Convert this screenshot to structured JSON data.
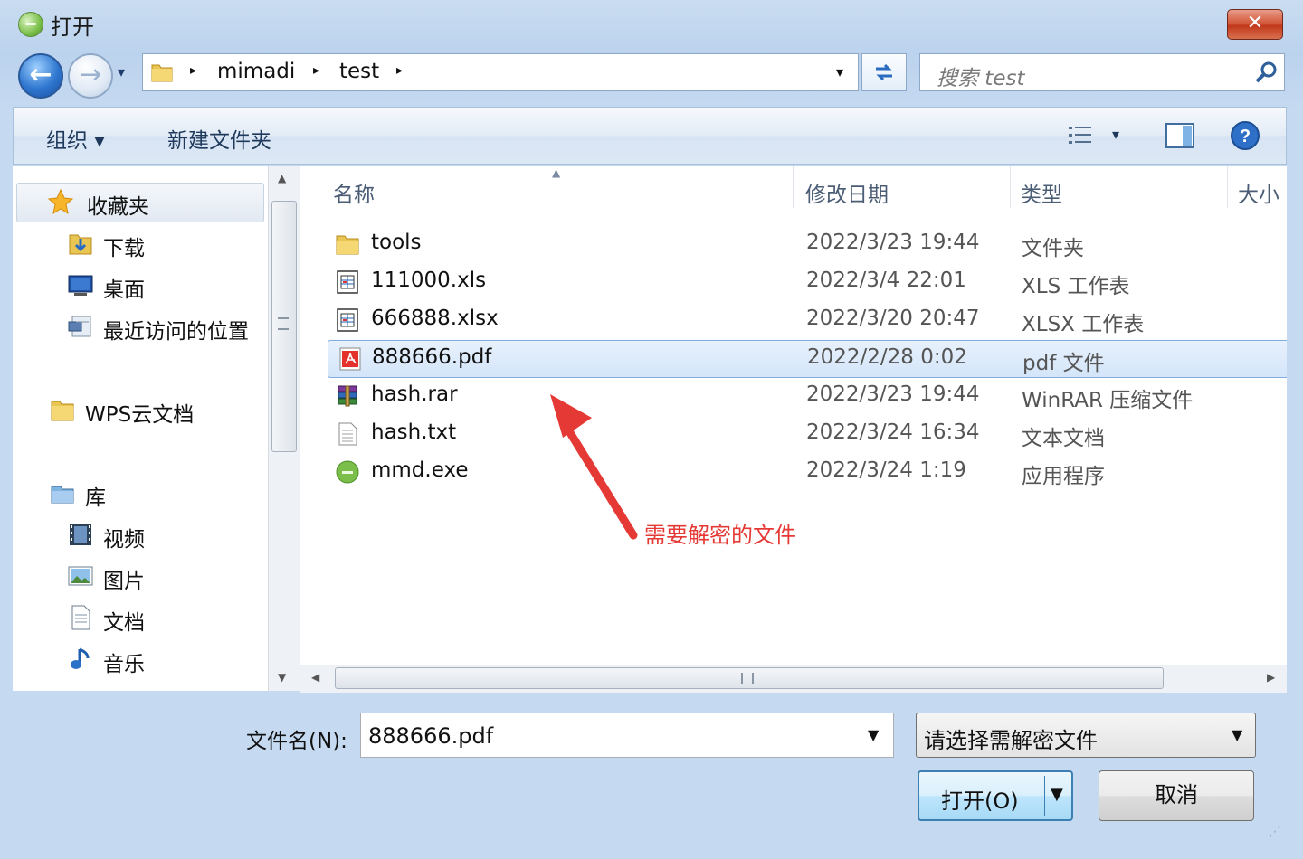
{
  "window": {
    "title": "打开",
    "close_label": "✕"
  },
  "nav": {
    "back_glyph": "←",
    "forward_glyph": "→",
    "recent_glyph": "▾"
  },
  "address": {
    "crumbs": [
      "mimadi",
      "test"
    ],
    "separator": "▸",
    "dropdown_glyph": "▾"
  },
  "search": {
    "placeholder": "搜索 test"
  },
  "toolbar": {
    "organize_label": "组织 ▾",
    "new_folder_label": "新建文件夹",
    "view_dropdown_glyph": "▾"
  },
  "sidebar": {
    "favorites_label": "收藏夹",
    "items": [
      {
        "label": "下载",
        "icon": "download-folder-icon"
      },
      {
        "label": "桌面",
        "icon": "desktop-icon"
      },
      {
        "label": "最近访问的位置",
        "icon": "recent-places-icon"
      }
    ],
    "wps_label": "WPS云文档",
    "library_label": "库",
    "library_items": [
      {
        "label": "视频",
        "icon": "video-icon"
      },
      {
        "label": "图片",
        "icon": "picture-icon"
      },
      {
        "label": "文档",
        "icon": "document-icon"
      },
      {
        "label": "音乐",
        "icon": "music-icon"
      }
    ]
  },
  "columns": {
    "name": "名称",
    "modified": "修改日期",
    "type": "类型",
    "size": "大小"
  },
  "files": [
    {
      "name": "tools",
      "date": "2022/3/23 19:44",
      "type": "文件夹",
      "icon": "folder-icon",
      "selected": false
    },
    {
      "name": "111000.xls",
      "date": "2022/3/4 22:01",
      "type": "XLS 工作表",
      "icon": "spreadsheet-icon",
      "selected": false
    },
    {
      "name": "666888.xlsx",
      "date": "2022/3/20 20:47",
      "type": "XLSX 工作表",
      "icon": "spreadsheet-icon",
      "selected": false
    },
    {
      "name": "888666.pdf",
      "date": "2022/2/28 0:02",
      "type": "pdf 文件",
      "icon": "pdf-icon",
      "selected": true
    },
    {
      "name": "hash.rar",
      "date": "2022/3/23 19:44",
      "type": "WinRAR 压缩文件",
      "icon": "winrar-icon",
      "selected": false
    },
    {
      "name": "hash.txt",
      "date": "2022/3/24 16:34",
      "type": "文本文档",
      "icon": "text-file-icon",
      "selected": false
    },
    {
      "name": "mmd.exe",
      "date": "2022/3/24 1:19",
      "type": "应用程序",
      "icon": "app-exe-icon",
      "selected": false
    }
  ],
  "annotation": {
    "text": "需要解密的文件",
    "color": "#e53935"
  },
  "bottom": {
    "filename_label": "文件名(N):",
    "filename_value": "888666.pdf",
    "filter_value": "请选择需解密文件",
    "open_label": "打开(O)",
    "cancel_label": "取消"
  },
  "colors": {
    "accent": "#3c7fb1",
    "selection": "#d3e5fa",
    "annotation": "#e53935"
  }
}
